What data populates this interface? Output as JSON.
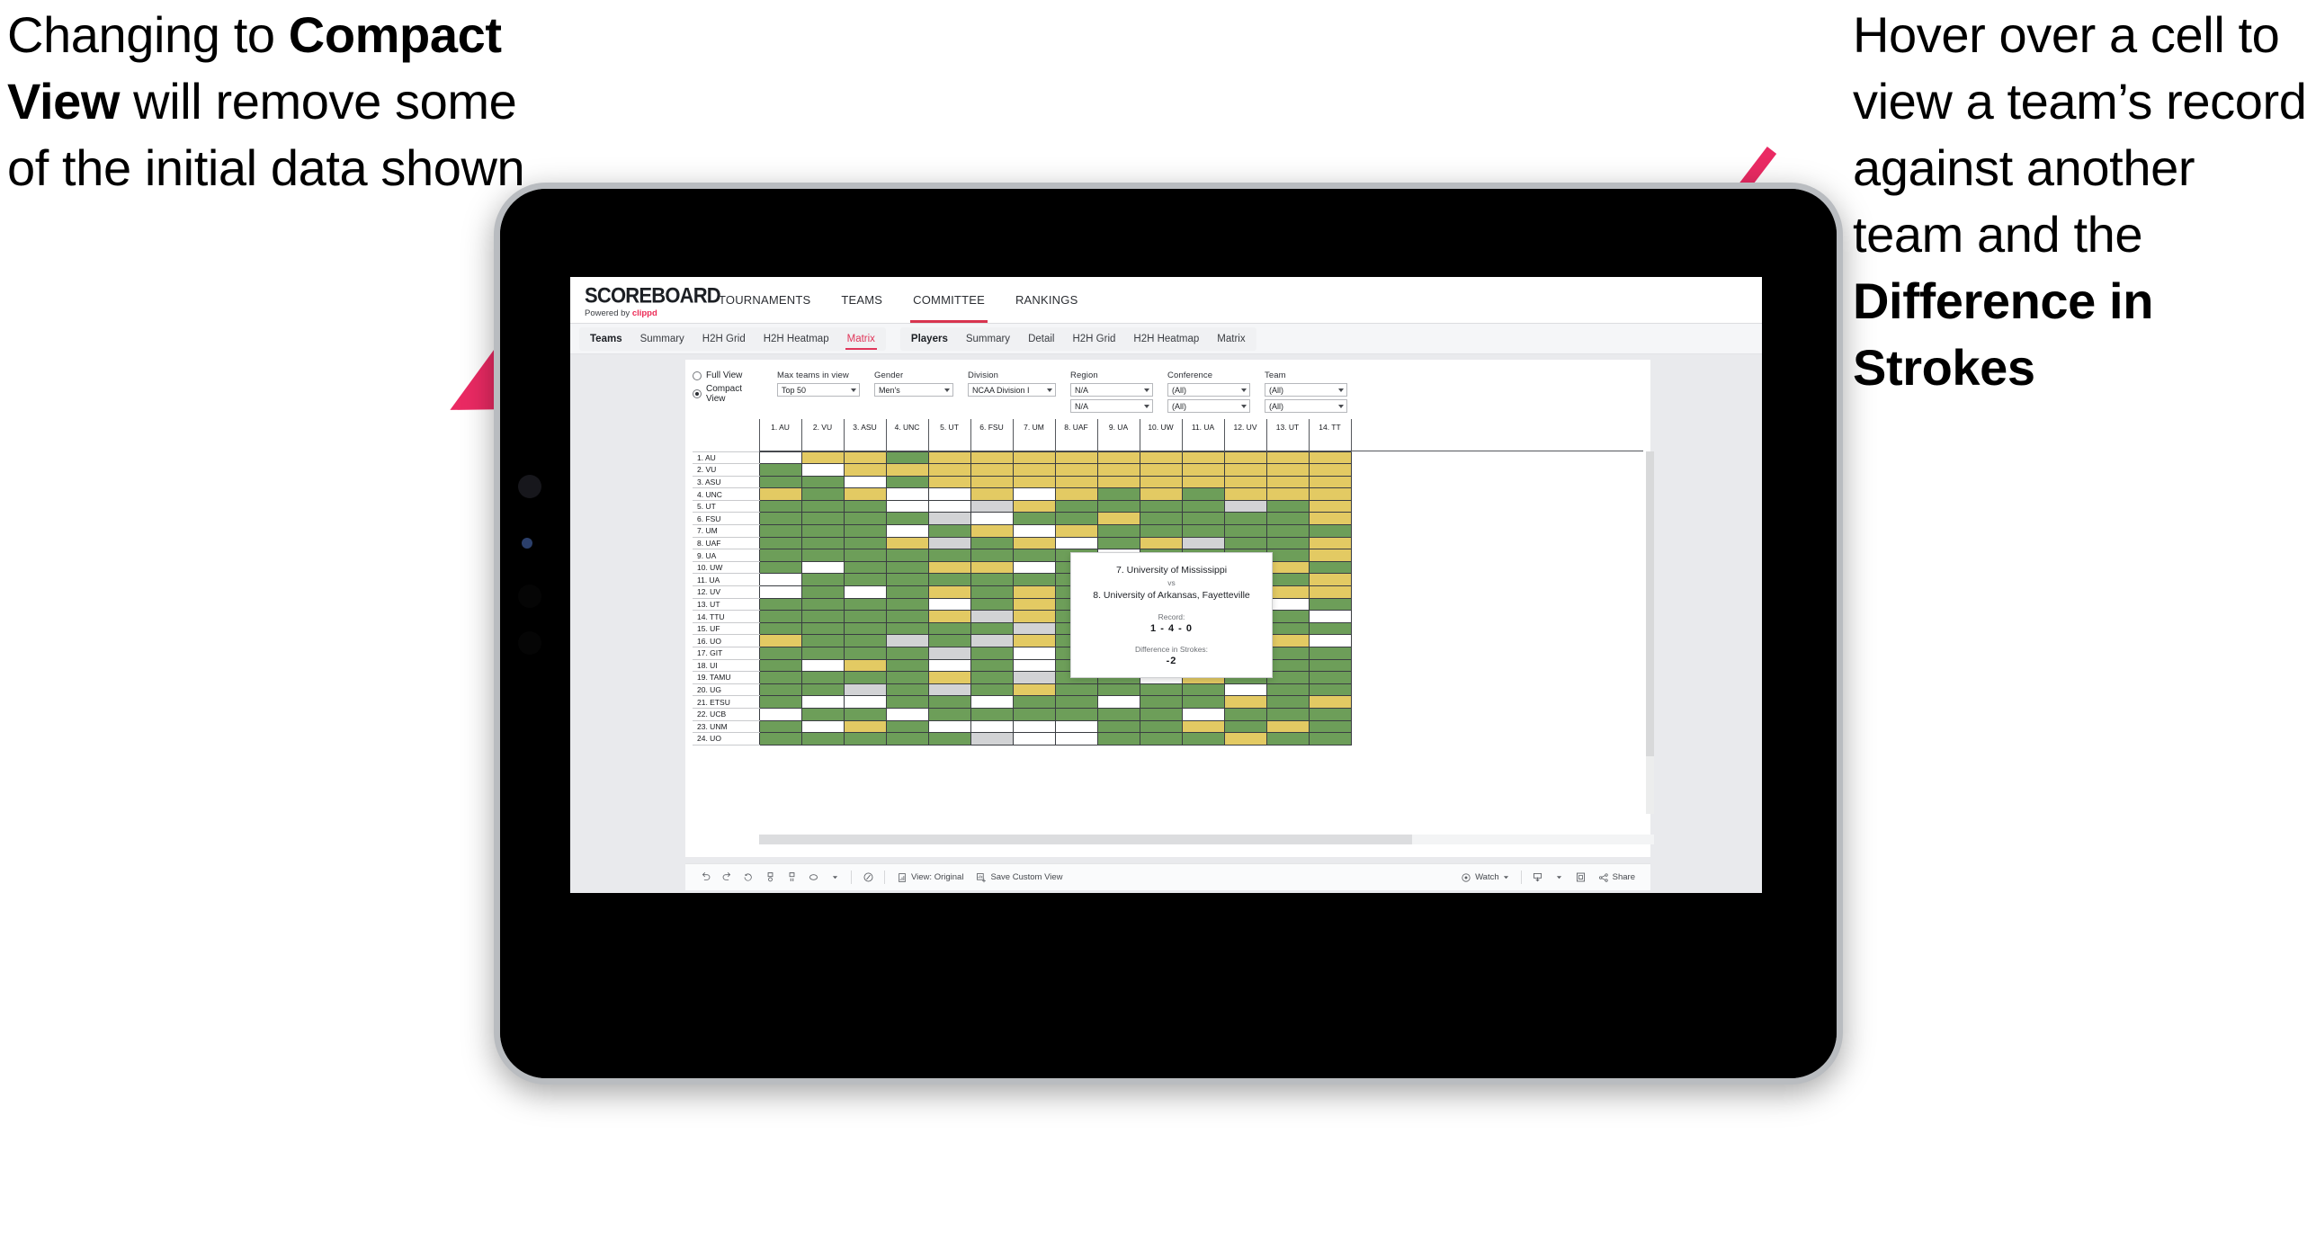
{
  "annotations": {
    "left": {
      "pre": "Changing to ",
      "bold": "Compact View",
      "post": " will remove some of the initial data shown"
    },
    "right": {
      "pre": "Hover over a cell to view a team’s record against another team and the ",
      "bold": "Difference in Strokes",
      "post": ""
    }
  },
  "brand": {
    "title": "SCOREBOARD",
    "powered_prefix": "Powered by ",
    "powered_name": "clippd",
    "accent": "#ec2b56"
  },
  "topnav": [
    {
      "label": "TOURNAMENTS",
      "active": false
    },
    {
      "label": "TEAMS",
      "active": false
    },
    {
      "label": "COMMITTEE",
      "active": true
    },
    {
      "label": "RANKINGS",
      "active": false
    }
  ],
  "subnav": {
    "teams_group": {
      "lead": "Teams",
      "items": [
        "Summary",
        "H2H Grid",
        "H2H Heatmap",
        "Matrix"
      ],
      "selected": "Matrix"
    },
    "players_group": {
      "lead": "Players",
      "items": [
        "Summary",
        "Detail",
        "H2H Grid",
        "H2H Heatmap",
        "Matrix"
      ],
      "selected": ""
    }
  },
  "filters": {
    "view_mode": {
      "options": [
        "Full View",
        "Compact View"
      ],
      "selected": "Compact View"
    },
    "controls": [
      {
        "label": "Max teams in view",
        "values": [
          "Top 50"
        ]
      },
      {
        "label": "Gender",
        "values": [
          "Men's"
        ]
      },
      {
        "label": "Division",
        "values": [
          "NCAA Division I"
        ]
      },
      {
        "label": "Region",
        "values": [
          "N/A",
          "N/A"
        ]
      },
      {
        "label": "Conference",
        "values": [
          "(All)",
          "(All)"
        ]
      },
      {
        "label": "Team",
        "values": [
          "(All)",
          "(All)"
        ]
      }
    ]
  },
  "tooltip": {
    "team_a": "7. University of Mississippi",
    "vs": "vs",
    "team_b": "8. University of Arkansas, Fayetteville",
    "record_label": "Record:",
    "record_value": "1 - 4 - 0",
    "diff_label": "Difference in Strokes:",
    "diff_value": "-2"
  },
  "toolbar": {
    "view_label": "View: Original",
    "save_label": "Save Custom View",
    "watch_label": "Watch",
    "share_label": "Share"
  },
  "chart_data": {
    "type": "heatmap",
    "title": "Team Head-to-Head Matrix",
    "legend": {
      "green": "#6d9e59",
      "yellow": "#e3ca63",
      "gray": "#d2d3d5",
      "white": "#ffffff"
    },
    "categories": [
      "1. AU",
      "2. VU",
      "3. ASU",
      "4. UNC",
      "5. UT",
      "6. FSU",
      "7. UM",
      "8. UAF",
      "9. UA",
      "10. UW",
      "11. UA",
      "12. UV",
      "13. UT",
      "14. TT"
    ],
    "rows": [
      "1. AU",
      "2. VU",
      "3. ASU",
      "4. UNC",
      "5. UT",
      "6. FSU",
      "7. UM",
      "8. UAF",
      "9. UA",
      "10. UW",
      "11. UA",
      "12. UV",
      "13. UT",
      "14. TTU",
      "15. UF",
      "16. UO",
      "17. GIT",
      "18. UI",
      "19. TAMU",
      "20. UG",
      "21. ETSU",
      "22. UCB",
      "23. UNM",
      "24. UO"
    ],
    "values": [
      [
        "n",
        "y",
        "y",
        "g",
        "y",
        "y",
        "y",
        "y",
        "y",
        "y",
        "y",
        "y",
        "y",
        "y"
      ],
      [
        "g",
        "n",
        "y",
        "y",
        "y",
        "y",
        "y",
        "y",
        "y",
        "y",
        "y",
        "y",
        "y",
        "y"
      ],
      [
        "g",
        "g",
        "n",
        "g",
        "y",
        "y",
        "y",
        "y",
        "y",
        "y",
        "y",
        "y",
        "y",
        "y"
      ],
      [
        "y",
        "g",
        "y",
        "n",
        "w",
        "y",
        "w",
        "y",
        "g",
        "y",
        "g",
        "y",
        "y",
        "y"
      ],
      [
        "g",
        "g",
        "g",
        "w",
        "n",
        "a",
        "y",
        "g",
        "g",
        "g",
        "g",
        "a",
        "g",
        "y"
      ],
      [
        "g",
        "g",
        "g",
        "g",
        "a",
        "n",
        "g",
        "g",
        "y",
        "g",
        "g",
        "g",
        "g",
        "y"
      ],
      [
        "g",
        "g",
        "g",
        "w",
        "g",
        "y",
        "n",
        "y",
        "g",
        "g",
        "g",
        "g",
        "g",
        "g"
      ],
      [
        "g",
        "g",
        "g",
        "y",
        "a",
        "g",
        "y",
        "n",
        "g",
        "y",
        "a",
        "g",
        "g",
        "y"
      ],
      [
        "g",
        "g",
        "g",
        "g",
        "g",
        "g",
        "g",
        "g",
        "n",
        "g",
        "g",
        "g",
        "g",
        "y"
      ],
      [
        "g",
        "w",
        "g",
        "g",
        "y",
        "y",
        "w",
        "g",
        "g",
        "n",
        "g",
        "a",
        "y",
        "g"
      ],
      [
        "w",
        "g",
        "g",
        "g",
        "g",
        "g",
        "g",
        "g",
        "g",
        "g",
        "n",
        "g",
        "g",
        "y"
      ],
      [
        "w",
        "g",
        "w",
        "g",
        "y",
        "g",
        "y",
        "g",
        "y",
        "g",
        "y",
        "n",
        "y",
        "y"
      ],
      [
        "g",
        "g",
        "g",
        "g",
        "w",
        "g",
        "y",
        "g",
        "g",
        "g",
        "g",
        "g",
        "n",
        "g"
      ],
      [
        "g",
        "g",
        "g",
        "g",
        "y",
        "a",
        "y",
        "g",
        "g",
        "g",
        "g",
        "g",
        "g",
        "n"
      ],
      [
        "g",
        "g",
        "g",
        "g",
        "g",
        "g",
        "a",
        "g",
        "g",
        "g",
        "g",
        "w",
        "g",
        "g"
      ],
      [
        "y",
        "g",
        "g",
        "a",
        "g",
        "a",
        "y",
        "g",
        "g",
        "w",
        "g",
        "w",
        "y",
        "w"
      ],
      [
        "g",
        "g",
        "g",
        "g",
        "a",
        "g",
        "w",
        "g",
        "g",
        "g",
        "g",
        "w",
        "g",
        "g"
      ],
      [
        "g",
        "w",
        "y",
        "g",
        "w",
        "g",
        "w",
        "g",
        "g",
        "g",
        "g",
        "w",
        "g",
        "g"
      ],
      [
        "g",
        "g",
        "g",
        "g",
        "y",
        "g",
        "a",
        "g",
        "g",
        "w",
        "y",
        "g",
        "g",
        "g"
      ],
      [
        "g",
        "g",
        "a",
        "g",
        "a",
        "g",
        "y",
        "g",
        "g",
        "g",
        "g",
        "w",
        "g",
        "g"
      ],
      [
        "g",
        "w",
        "w",
        "g",
        "g",
        "w",
        "g",
        "g",
        "w",
        "g",
        "g",
        "y",
        "g",
        "y"
      ],
      [
        "w",
        "g",
        "g",
        "w",
        "g",
        "g",
        "g",
        "g",
        "g",
        "g",
        "w",
        "g",
        "g",
        "g"
      ],
      [
        "g",
        "w",
        "y",
        "g",
        "w",
        "w",
        "w",
        "w",
        "g",
        "g",
        "y",
        "g",
        "y",
        "g"
      ],
      [
        "g",
        "g",
        "g",
        "g",
        "g",
        "a",
        "w",
        "w",
        "g",
        "g",
        "g",
        "y",
        "g",
        "g"
      ]
    ]
  }
}
